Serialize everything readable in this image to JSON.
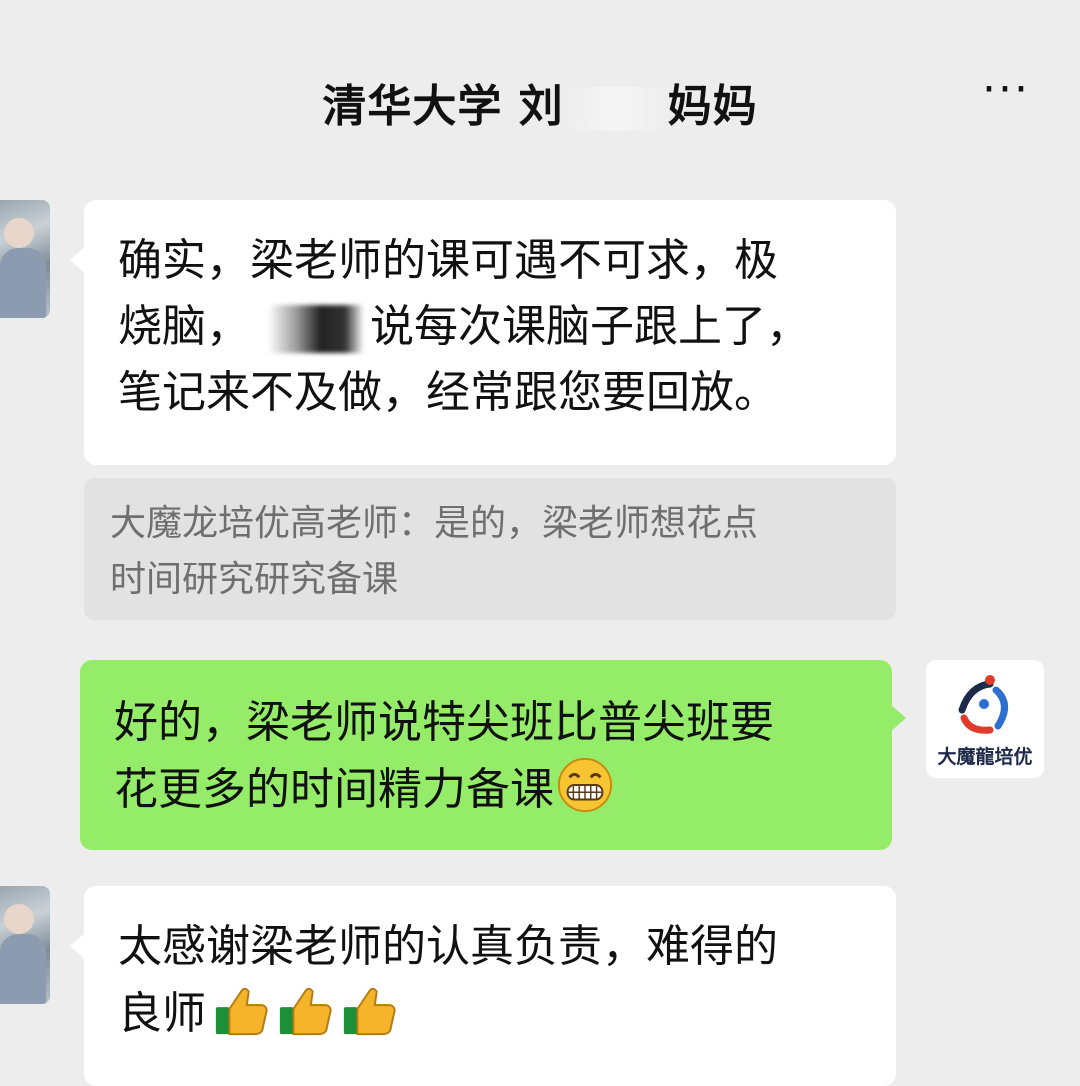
{
  "header": {
    "title_part1": "清华大学 刘",
    "title_part2": "妈妈",
    "more_label": "···"
  },
  "messages": [
    {
      "line1": "确实，梁老师的课可遇不可求，极",
      "line2a": "烧脑，",
      "line2b": "说每次课脑子跟上了，",
      "line3": "笔记来不及做，经常跟您要回放。"
    },
    {
      "quote_line1": "大魔龙培优高老师：是的，梁老师想花点",
      "quote_line2": "时间研究研究备课"
    },
    {
      "line1": "好的，梁老师说特尖班比普尖班要",
      "line2": "花更多的时间精力备课"
    },
    {
      "line1": "太感谢梁老师的认真负责，难得的",
      "line2": "良师"
    }
  ],
  "right_avatar": {
    "logo_text": "大魔龍培优"
  },
  "colors": {
    "background": "#ededed",
    "green_bubble": "#95ec69",
    "white_bubble": "#ffffff",
    "quote_bg": "#e2e2e2"
  },
  "icons": [
    "more-icon",
    "grinning-emoji-icon",
    "thumbs-up-icon"
  ]
}
